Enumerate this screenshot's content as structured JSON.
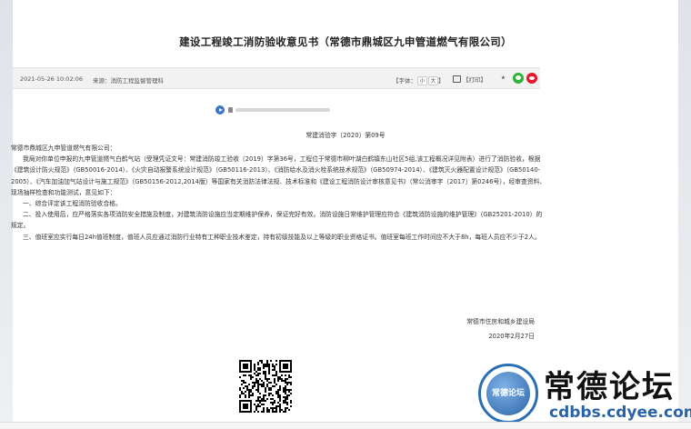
{
  "title": "建设工程竣工消防验收意见书（常德市鼎城区九申管道燃气有限公司）",
  "meta": {
    "date": "2021-05-26 10:02:06",
    "source": "来源：消防工程监督管理科",
    "font_label": "【字体：",
    "font_small": "小",
    "font_large": "大",
    "font_close": "】",
    "print_label": "【打印】",
    "share_icon": "share-icon",
    "wechat_icon": "wechat-icon",
    "weibo_icon": "weibo-icon"
  },
  "document": {
    "number": "常建消验字〔2020〕第09号",
    "salutation": "常德市鼎城区九申管道燃气有限公司：",
    "paragraph_1": "我局对你单位申报的九申管道燃气白鹤气站（受理凭证文号：常建消防竣工验收〔2019〕字第36号，工程位于常德市柳叶湖白鹤镇东山社区5组,该工程概况详见附表）进行了消防验收，根据《建筑设计防火规范》（GB50016-2014）、《火灾自动报警系统设计规范》（GB50116-2013）、《消防给水及消火栓系统技术规范》（GB50974-2014）、《建筑灭火器配置设计规范》（GB50140-2005）、《汽车加油加气站设计与施工规范》（GB50156-2012,2014版）等国家有关消防法律法规、技术标准和《建设工程消防设计审核意见书》（常公消审字〔2017〕第0246号），经审查资料、现场抽样检查和功能测试，意见如下：",
    "item_1": "一、综合评定该工程消防验收合格。",
    "item_2": "二、投入使用后，应严格落实各项消防安全措施及制度，对建筑消防设施应当定期维护保养，保证完好有效。消防设施日常维护管理应符合《建筑消防设施的维护管理》（GB25201-2010）的规定。",
    "item_3": "三、值班室应实行每日24h值班制度，值班人员应通过消防行业特有工种职业技术鉴定，持有初级技能及以上等级的职业资格证书。值班室每班工作时间应不大于8h，每班人员应不少于2人。",
    "signature_org": "常德市住房和城乡建设局",
    "signature_date": "2020年2月27日"
  },
  "watermark": {
    "seal_text": "常德论坛",
    "title": "常德论坛",
    "url": "cdbbs.cdyee.com"
  },
  "colors": {
    "wechat": "#2fb33b",
    "weibo": "#e6162d",
    "audio_play": "#3c74c9",
    "watermark_blue": "#2a63a8"
  }
}
